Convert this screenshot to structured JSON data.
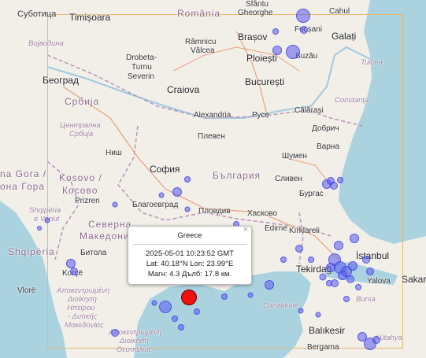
{
  "map": {
    "bbox_color": "#e6b86a",
    "water_color": "#aad3df",
    "land_color": "#f2efe9",
    "marker_color": "#ee1111",
    "dot_color": "#5a5af0"
  },
  "labels": {
    "subotica": "Суботица",
    "timisoara": "Timișoara",
    "romania": "România",
    "sfantu": "Sfântu",
    "gheorghe": "Gheorghe",
    "focsani": "Focșani",
    "cahul": "Cahul",
    "brasov": "Brașov",
    "galati": "Galați",
    "vojvodina": "Војводина",
    "ramnicu": "Râmnicu",
    "valcea": "Vâlcea",
    "buzau": "Buzău",
    "drobeta": "Drobeta-",
    "turnu": "Turnu",
    "severin": "Severin",
    "ploiesti": "Ploiești",
    "tulcea": "Tulcea",
    "beograd": "Београд",
    "bucuresti": "București",
    "craiova": "Craiova",
    "srbija": "Србија",
    "constanta": "Constanța",
    "calarasi": "Călărași",
    "alexandria": "Alexandria",
    "ruse": "Русе",
    "centralna": "Централна",
    "srbija2": "Србија",
    "dobrich": "Добрич",
    "pleven": "Плевен",
    "varna": "Варна",
    "nis": "Ниш",
    "shumen": "Шумен",
    "sofia": "София",
    "bulgaria": "България",
    "sliven": "Сливен",
    "ora_gora": "na Gora /",
    "ona_gora": "она Гора",
    "kosovo": "Kosovo /",
    "kosovo2": "Косово",
    "burgas": "Бургас",
    "prizren": "Prizren",
    "blagoevgrad": "Благоевград",
    "plovdiv": "Пловдив",
    "haskovo": "Хасково",
    "shqiperia_v": "Shqipëria",
    "e_veriut": "e Veriut",
    "severna": "Северна",
    "makedonija": "Македонија",
    "edirne": "Edirne",
    "kirklareli": "Kırklareli",
    "shqiperia": "Shqipëria",
    "bitola": "Битола",
    "istanbul": "İstanbul",
    "tekirdag": "Tekirdağ",
    "sakarya": "Sakar",
    "korce": "Korçë",
    "yalova": "Yalova",
    "vlore": "Vlorë",
    "decentr1": "Αποκεντρωμένη",
    "dioikisi": "Διοίκηση",
    "ipeirou": "Ηπείρου",
    "dytikis": "- Δυτικής",
    "makedonias": "Μακεδονίας",
    "canakkale": "Çanakkale",
    "bursa": "Bursa",
    "decentr2": "Αποκεντρωμένη",
    "dioikisi2": "Διοίκηση",
    "thessalias": "Θεσσαλίας -",
    "balikesir": "Balıkesir",
    "kutahya": "Kütahya",
    "bergama": "Bergama"
  },
  "popup": {
    "title": "Greece",
    "datetime": "2025-05-01 10:23:52 GMT",
    "coords": "Lat: 40.18°N Lon: 23.99°E",
    "magnitude": "Магн: 4.3 Дълб: 17.8 км.",
    "close": "×"
  }
}
